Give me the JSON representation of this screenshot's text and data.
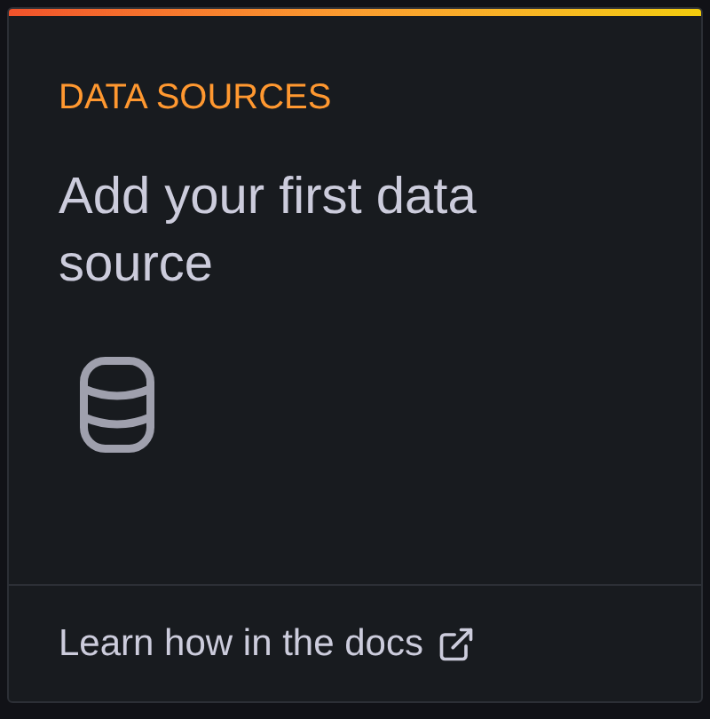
{
  "card": {
    "label": "DATA SOURCES",
    "heading": "Add your first data source",
    "link": "Learn how in the docs"
  }
}
